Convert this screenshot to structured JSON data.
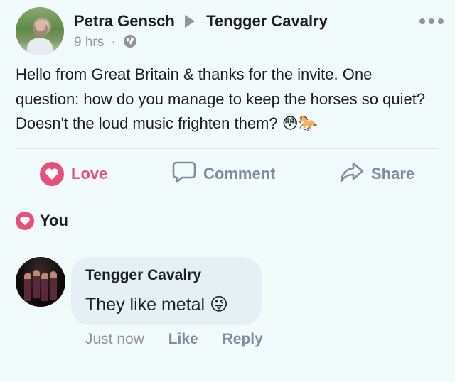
{
  "post": {
    "author": "Petra Gensch",
    "target_page": "Tengger Cavalry",
    "timestamp": "9 hrs",
    "separator": "·",
    "privacy_icon": "globe-icon",
    "body": "Hello from Great Britain & thanks for the invite. One question: how do you manage to keep the horses so quiet? Doesn't the loud music frighten them? 😳🐎"
  },
  "actions": {
    "love_label": "Love",
    "comment_label": "Comment",
    "share_label": "Share"
  },
  "reactions": {
    "summary": "You",
    "icon": "heart-icon"
  },
  "comment": {
    "author": "Tengger Cavalry",
    "text": "They like metal 😜",
    "time": "Just now",
    "like_label": "Like",
    "reply_label": "Reply"
  },
  "colors": {
    "love": "#e65179",
    "muted": "#90949c",
    "action": "#7f8da0",
    "background": "#f2fbfb",
    "bubble": "#e4f0f3"
  }
}
